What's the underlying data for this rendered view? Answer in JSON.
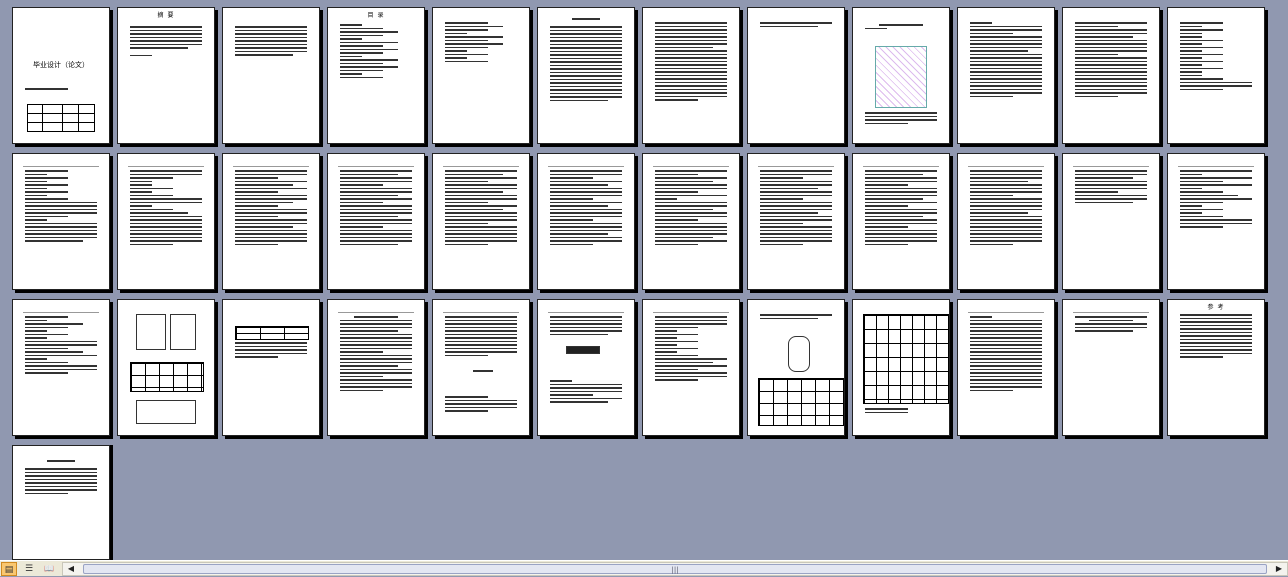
{
  "document": {
    "cover_title": "毕业设计（论文）",
    "toc_title": "目 录",
    "abstract_title": "摘 要",
    "references_title": "参 考"
  },
  "statusbar": {
    "view_buttons": [
      {
        "icon": "normal-view-icon",
        "glyph": "▤"
      },
      {
        "icon": "outline-view-icon",
        "glyph": "☰"
      },
      {
        "icon": "reading-view-icon",
        "glyph": "📖"
      }
    ],
    "scroll_left": "◀",
    "scroll_right": "▶",
    "scroll_grip": "|||"
  },
  "colors": {
    "workspace": "#9098b0",
    "page": "#ffffff",
    "active_button": "#f9c770"
  }
}
